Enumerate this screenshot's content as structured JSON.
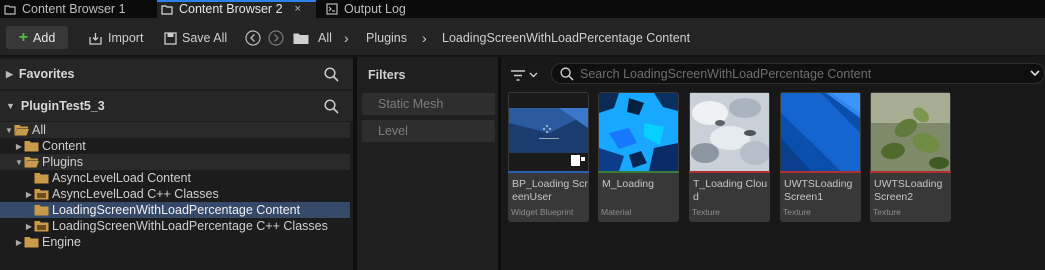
{
  "tabs": [
    {
      "label": "Content Browser 1",
      "active": false
    },
    {
      "label": "Content Browser 2",
      "active": true
    },
    {
      "label": "Output Log",
      "active": false
    }
  ],
  "toolbar": {
    "add_label": "Add",
    "import_label": "Import",
    "save_all_label": "Save All"
  },
  "breadcrumb": [
    "All",
    "Plugins",
    "LoadingScreenWithLoadPercentage Content"
  ],
  "favorites": {
    "label": "Favorites"
  },
  "project": {
    "label": "PluginTest5_3"
  },
  "tree": [
    {
      "label": "All",
      "depth": 0,
      "expanded": true
    },
    {
      "label": "Content",
      "depth": 1,
      "expanded": false
    },
    {
      "label": "Plugins",
      "depth": 1,
      "expanded": true
    },
    {
      "label": "AsyncLevelLoad Content",
      "depth": 2
    },
    {
      "label": "AsyncLevelLoad C++ Classes",
      "depth": 2,
      "expanded": false
    },
    {
      "label": "LoadingScreenWithLoadPercentage Content",
      "depth": 2,
      "selected": true
    },
    {
      "label": "LoadingScreenWithLoadPercentage C++ Classes",
      "depth": 2,
      "expanded": false
    },
    {
      "label": "Engine",
      "depth": 1,
      "expanded": false
    }
  ],
  "filters": {
    "title": "Filters",
    "items": [
      "Static Mesh",
      "Level"
    ]
  },
  "search": {
    "placeholder": "Search LoadingScreenWithLoadPercentage Content"
  },
  "assets": [
    {
      "name": "BP_Loading ScreenUser",
      "type": "Widget Blueprint",
      "color": "#2a5fb0"
    },
    {
      "name": "M_Loading",
      "type": "Material",
      "color": "#3a7d3a"
    },
    {
      "name": "T_Loading Cloud",
      "type": "Texture",
      "color": "#b03030"
    },
    {
      "name": "UWTSLoading Screen1",
      "type": "Texture",
      "color": "#b03030"
    },
    {
      "name": "UWTSLoading Screen2",
      "type": "Texture",
      "color": "#b03030"
    }
  ],
  "colors": {
    "accent": "#2f80ed",
    "selection": "#344a68",
    "folder": "#c99a49",
    "add_plus": "#4fc03f"
  }
}
